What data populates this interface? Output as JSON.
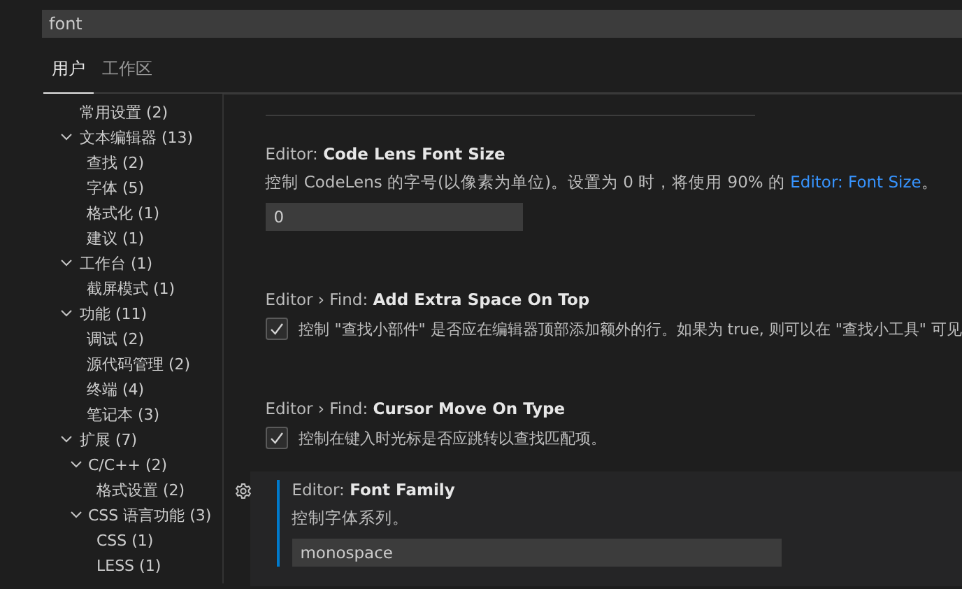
{
  "search": {
    "value": "font"
  },
  "tabs": [
    {
      "label": "用户",
      "selected": true
    },
    {
      "label": "工作区",
      "selected": false
    }
  ],
  "tree": [
    {
      "label": "常用设置 (2)"
    },
    {
      "label": "文本编辑器 (13)",
      "expanded": true,
      "children": [
        {
          "label": "查找 (2)"
        },
        {
          "label": "字体 (5)"
        },
        {
          "label": "格式化 (1)"
        },
        {
          "label": "建议 (1)"
        }
      ]
    },
    {
      "label": "工作台 (1)",
      "expanded": true,
      "children": [
        {
          "label": "截屏模式 (1)"
        }
      ]
    },
    {
      "label": "功能 (11)",
      "expanded": true,
      "children": [
        {
          "label": "调试 (2)"
        },
        {
          "label": "源代码管理 (2)"
        },
        {
          "label": "终端 (4)"
        },
        {
          "label": "笔记本 (3)"
        }
      ]
    },
    {
      "label": "扩展 (7)",
      "expanded": true,
      "children": [
        {
          "label": "C/C++ (2)",
          "expanded": true,
          "children": [
            {
              "label": "格式设置 (2)"
            }
          ]
        },
        {
          "label": "CSS 语言功能 (3)",
          "expanded": true,
          "children": [
            {
              "label": "CSS (1)"
            },
            {
              "label": "LESS (1)"
            }
          ]
        }
      ]
    }
  ],
  "settings": [
    {
      "kind": "number",
      "prefix": "Editor: ",
      "name": "Code Lens Font Size",
      "description": "控制 CodeLens 的字号(以像素为单位)。设置为 0 时，将使用 90% 的 ",
      "link": "Editor: Font Size",
      "description_end": "。",
      "value": "0",
      "focused": false
    },
    {
      "kind": "checkbox",
      "prefix": "Editor › Find: ",
      "name": "Add Extra Space On Top",
      "description": "控制 \"查找小部件\" 是否应在编辑器顶部添加额外的行。如果为 true, 则可以在 \"查找小工具\" 可见",
      "checked": true,
      "focused": false
    },
    {
      "kind": "checkbox",
      "prefix": "Editor › Find: ",
      "name": "Cursor Move On Type",
      "description": "控制在键入时光标是否应跳转以查找匹配项。",
      "checked": true,
      "focused": false
    },
    {
      "kind": "text",
      "prefix": "Editor: ",
      "name": "Font Family",
      "description": "控制字体系列。",
      "value": "monospace",
      "focused": true
    }
  ]
}
